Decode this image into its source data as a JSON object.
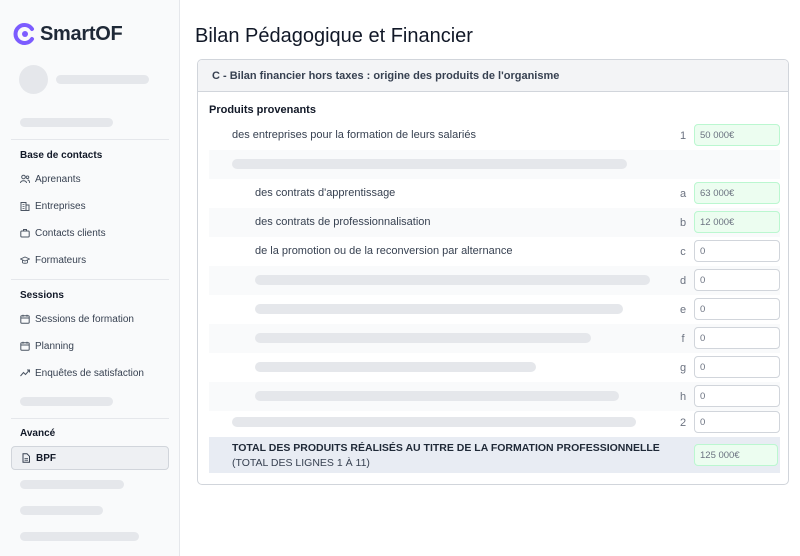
{
  "app": {
    "name": "SmartOF",
    "brand_color": "#7c5cff"
  },
  "sidebar": {
    "sections": [
      {
        "title": "Base de contacts",
        "items": [
          {
            "label": "Aprenants",
            "icon": "users-icon"
          },
          {
            "label": "Entreprises",
            "icon": "building-icon"
          },
          {
            "label": "Contacts clients",
            "icon": "briefcase-icon"
          },
          {
            "label": "Formateurs",
            "icon": "graduation-cap-icon"
          }
        ]
      },
      {
        "title": "Sessions",
        "items": [
          {
            "label": "Sessions de formation",
            "icon": "calendar-icon"
          },
          {
            "label": "Planning",
            "icon": "calendar-icon"
          },
          {
            "label": "Enquêtes de satisfaction",
            "icon": "trending-icon"
          }
        ]
      },
      {
        "title": "Avancé",
        "items": [
          {
            "label": "BPF",
            "icon": "document-icon",
            "active": true
          }
        ]
      }
    ]
  },
  "page": {
    "title": "Bilan Pédagogique et Financier"
  },
  "panel": {
    "header": "C - Bilan financier hors taxes : origine des produits de l'organisme",
    "subtitle": "Produits provenants",
    "rows": [
      {
        "label": "des entreprises pour la formation de leurs salariés",
        "code": "1",
        "value": "50 000€",
        "filled": true
      },
      {
        "label": "des contrats d'apprentissage",
        "code": "a",
        "value": "63 000€",
        "filled": true
      },
      {
        "label": "des contrats de professionnalisation",
        "code": "b",
        "value": "12 000€",
        "filled": true
      },
      {
        "label": "de la promotion ou de la reconversion par alternance",
        "code": "c",
        "value": "0",
        "filled": false
      },
      {
        "code": "d",
        "value": "0"
      },
      {
        "code": "e",
        "value": "0"
      },
      {
        "code": "f",
        "value": "0"
      },
      {
        "code": "g",
        "value": "0"
      },
      {
        "code": "h",
        "value": "0"
      },
      {
        "code": "2",
        "value": "0"
      }
    ],
    "total": {
      "label_line1": "TOTAL DES PRODUITS RÉALISÉS AU TITRE DE LA FORMATION PROFESSIONNELLE",
      "label_line2": "(TOTAL DES LIGNES 1 À 11)",
      "value": "125 000€"
    }
  }
}
